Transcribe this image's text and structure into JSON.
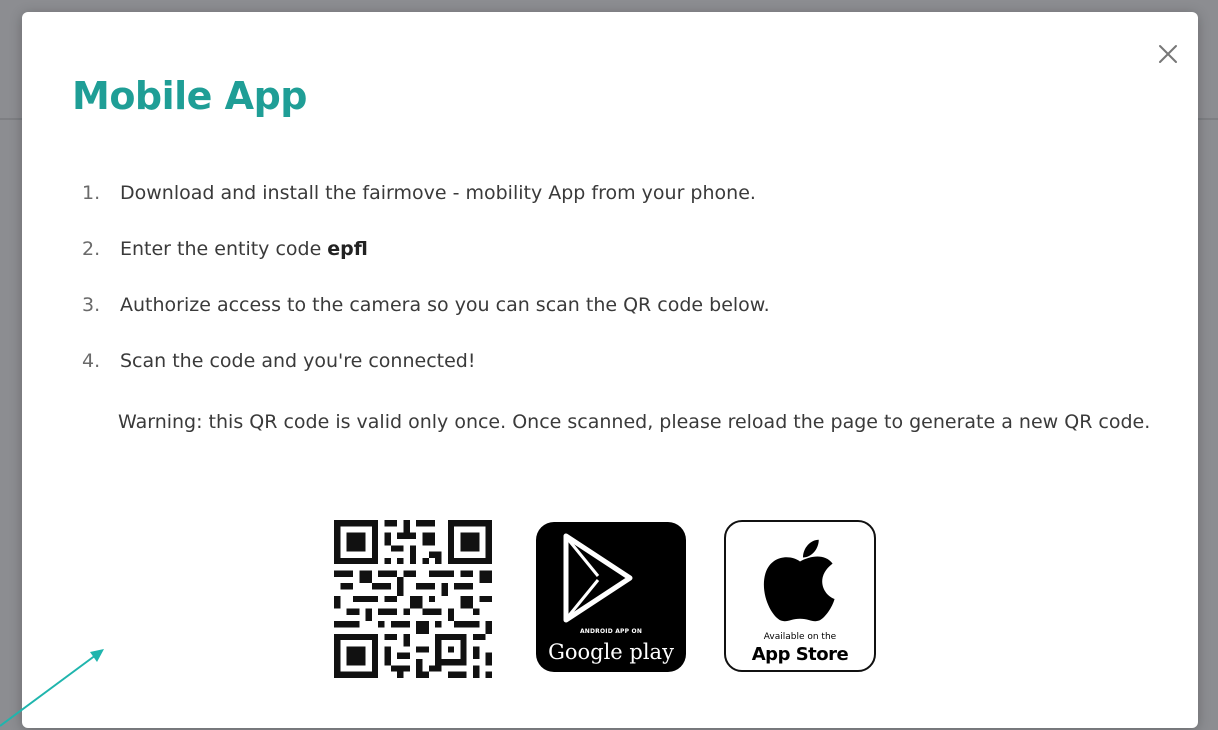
{
  "modal": {
    "title": "Mobile App",
    "close_label": "×"
  },
  "steps": [
    {
      "number": "1.",
      "text": "Download and install the fairmove - mobility App from your phone."
    },
    {
      "number": "2.",
      "text": "Enter the entity code",
      "code": "epfl"
    },
    {
      "number": "3.",
      "text": "Authorize access to the camera so you can scan the QR code below."
    },
    {
      "number": "4.",
      "text": "Scan the code and you're connected!"
    }
  ],
  "warning": "Warning: this QR code is valid only once. Once scanned, please reload the page to generate a new QR code.",
  "badges": {
    "google_play": {
      "small": "ANDROID APP ON",
      "big": "Google play"
    },
    "app_store": {
      "small": "Available on the",
      "big": "App Store"
    }
  },
  "colors": {
    "accent": "#1f9e96",
    "arrow": "#1fb5ad"
  }
}
